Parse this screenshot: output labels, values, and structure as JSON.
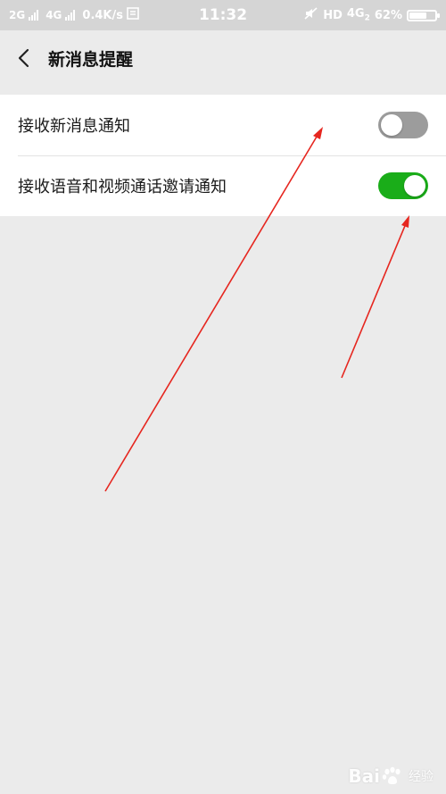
{
  "status_bar": {
    "net1": "2G",
    "net2": "4G",
    "speed": "0.4K/s",
    "time": "11:32",
    "hd": "HD",
    "net3": "4G",
    "net3_sub": "2",
    "battery": "62%",
    "battery_level": 0.62
  },
  "header": {
    "title": "新消息提醒"
  },
  "settings": [
    {
      "label": "接收新消息通知",
      "enabled": false
    },
    {
      "label": "接收语音和视频通话邀请通知",
      "enabled": true
    }
  ],
  "colors": {
    "toggle_on": "#1aad19",
    "toggle_off": "#9c9c9c",
    "arrow": "#e6261f"
  },
  "watermark": {
    "brand": "Bai",
    "brand_end": "经验"
  }
}
